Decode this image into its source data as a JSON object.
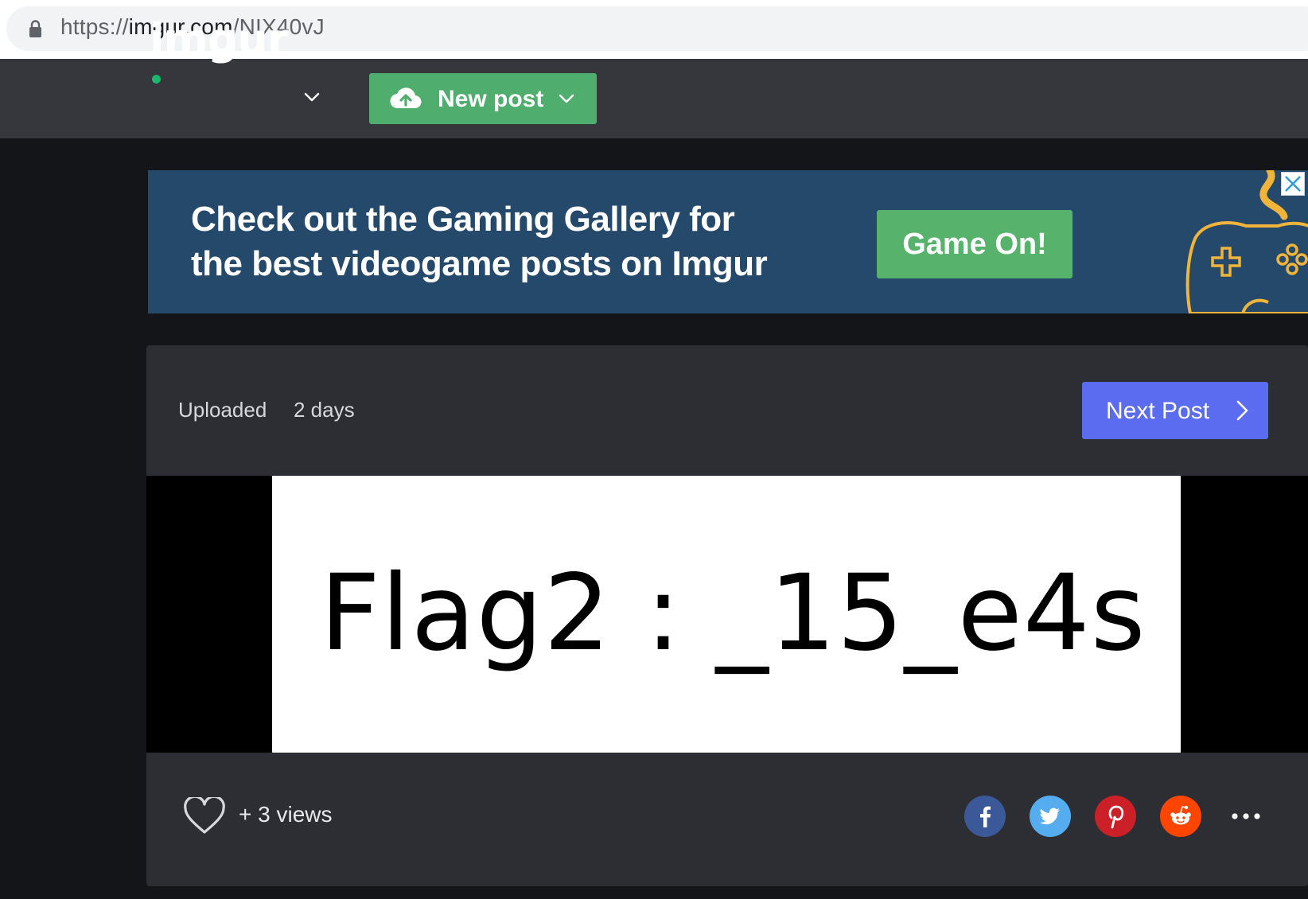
{
  "browser": {
    "url_scheme": "https://",
    "url_host": "imgur.com",
    "url_path": "/NIX40vJ"
  },
  "header": {
    "logo_text": "imgur",
    "new_post_label": "New post"
  },
  "banner": {
    "line1": "Check out the Gaming Gallery for",
    "line2": "the best videogame posts on Imgur",
    "cta_label": "Game On!"
  },
  "post": {
    "uploaded_label": "Uploaded",
    "uploaded_value": "2 days",
    "next_post_label": "Next Post",
    "image_text": "Flag2 : _15_e4s",
    "views_text": "+ 3 views"
  },
  "share_icons": [
    "facebook-icon",
    "twitter-icon",
    "pinterest-icon",
    "reddit-icon",
    "more-icon"
  ],
  "colors": {
    "new_post": "#4fad6e",
    "next_post": "#5b6cf0",
    "banner_bg": "#25496a",
    "game_on": "#57b36b"
  }
}
